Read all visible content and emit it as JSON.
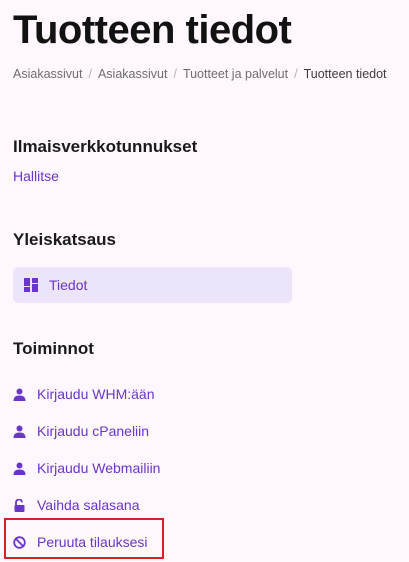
{
  "page_title": "Tuotteen tiedot",
  "breadcrumb": [
    "Asiakassivut",
    "Asiakassivut",
    "Tuotteet ja palvelut",
    "Tuotteen tiedot"
  ],
  "breadcrumb_separator": "/",
  "nameservers": {
    "heading": "Ilmaisverkkotunnukset",
    "manage_link": "Hallitse"
  },
  "overview": {
    "heading": "Yleiskatsaus",
    "item_label": "Tiedot",
    "item_icon": "dashboard-icon"
  },
  "actions": {
    "heading": "Toiminnot",
    "items": [
      {
        "label": "Kirjaudu WHM:ään",
        "icon": "user-icon"
      },
      {
        "label": "Kirjaudu cPaneliin",
        "icon": "user-icon"
      },
      {
        "label": "Kirjaudu Webmailiin",
        "icon": "user-icon"
      },
      {
        "label": "Vaihda salasana",
        "icon": "unlock-icon"
      },
      {
        "label": "Peruuta tilauksesi",
        "icon": "ban-icon"
      }
    ]
  },
  "colors": {
    "background": "#fff7fe",
    "link": "#6a35c9",
    "active_item_bg": "#ece4f8",
    "highlight_border": "#d61f26"
  }
}
